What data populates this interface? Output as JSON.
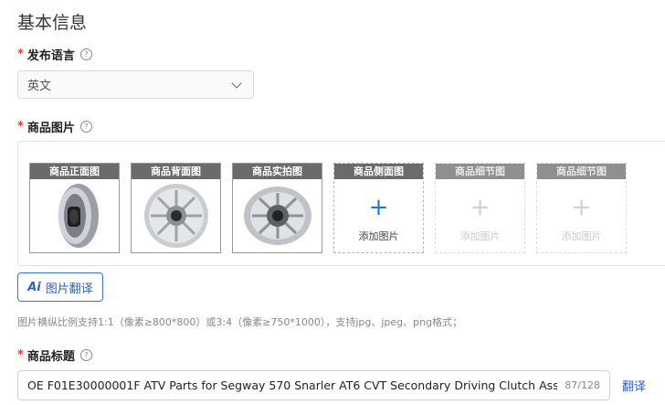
{
  "section_title": "基本信息",
  "publish_language": {
    "required_mark": "*",
    "label": "发布语言",
    "help_icon": "question-circle-icon",
    "value": "英文"
  },
  "product_images": {
    "required_mark": "*",
    "label": "商品图片",
    "help_icon": "question-circle-icon",
    "slots": [
      {
        "caption": "商品正面图",
        "state": "filled"
      },
      {
        "caption": "商品背面图",
        "state": "filled"
      },
      {
        "caption": "商品实拍图",
        "state": "filled"
      },
      {
        "caption": "商品侧面图",
        "state": "empty",
        "add_label": "添加图片"
      },
      {
        "caption": "商品细节图",
        "state": "disabled",
        "add_label": "添加图片"
      },
      {
        "caption": "商品细节图",
        "state": "disabled",
        "add_label": "添加图片"
      }
    ],
    "ai_button_mark": "Ai",
    "ai_button_label": "图片翻译",
    "hint": "图片横纵比例支持1:1（像素≥800*800）或3:4（像素≥750*1000），支持jpg、jpeg、png格式；"
  },
  "product_title": {
    "required_mark": "*",
    "label": "商品标题",
    "help_icon": "question-circle-icon",
    "value": "OE F01E30000001F ATV Parts for Segway 570 Snarler AT6 CVT Secondary Driving Clutch Ass",
    "counter": "87/128",
    "translate_label": "翻译"
  },
  "colors": {
    "accent": "#2a5fc7",
    "required": "#e53935",
    "caption_bg": "#6b6b6b"
  }
}
